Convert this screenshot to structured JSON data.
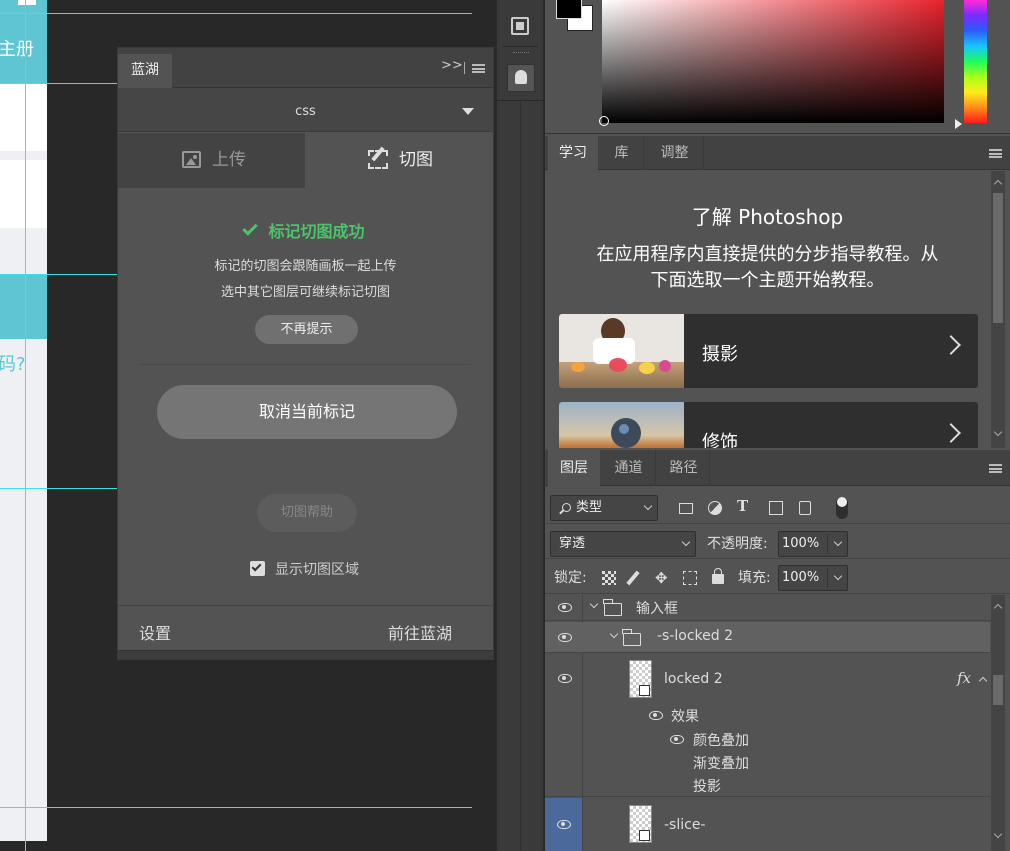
{
  "canvas": {
    "artboard_text_register": "主册",
    "artboard_text_forgot": "码?"
  },
  "plugin": {
    "tab_title": "蓝湖",
    "expand_icon": "double-chevron-right",
    "format_select": "css",
    "mode_upload": "上传",
    "mode_slice": "切图",
    "success_title": "标记切图成功",
    "info_line1": "标记的切图会跟随画板一起上传",
    "info_line2": "选中其它图层可继续标记切图",
    "dont_remind_button": "不再提示",
    "cancel_mark_button": "取消当前标记",
    "slice_help_button": "切图帮助",
    "show_slice_area_label": "显示切图区域",
    "show_slice_area_checked": true,
    "settings_link": "设置",
    "goto_lanhu_link": "前往蓝湖"
  },
  "learn_panel": {
    "tabs": [
      "学习",
      "库",
      "调整"
    ],
    "title": "了解 Photoshop",
    "description_line1": "在应用程序内直接提供的分步指导教程。从",
    "description_line2": "下面选取一个主题开始教程。",
    "topics": [
      "摄影",
      "修饰"
    ]
  },
  "layers_panel": {
    "tabs": [
      "图层",
      "通道",
      "路径"
    ],
    "filter_kind": "类型",
    "blend_mode": "穿透",
    "opacity_label": "不透明度:",
    "opacity_value": "100%",
    "lock_label": "锁定:",
    "fill_label": "填充:",
    "fill_value": "100%",
    "layers": {
      "group1": "输入框",
      "group2": "-s-locked 2",
      "layer1": "locked 2",
      "fx": "fx",
      "effects": "效果",
      "effect1": "颜色叠加",
      "effect2": "渐变叠加",
      "effect3": "投影",
      "layer2": "-slice-"
    }
  },
  "colors": {
    "accent_cyan": "#3ee0e8",
    "success_green": "#4cc46a",
    "panel_bg": "#535353",
    "selected_layer": "#4b6a9b"
  }
}
